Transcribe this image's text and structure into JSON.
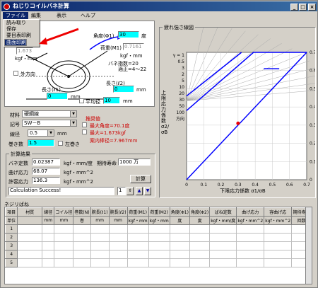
{
  "window": {
    "title": "ねじりコイルバネ計算",
    "min": "_",
    "max": "□",
    "close": "×"
  },
  "menu": [
    {
      "label": "ファイル"
    },
    {
      "label": "編集"
    },
    {
      "label": "表示"
    },
    {
      "label": "ヘルプ"
    }
  ],
  "file_menu": {
    "items": [
      "読み取り",
      "保存",
      "要目表印刷",
      "曲面印刷"
    ],
    "selected": 3
  },
  "diagram": {
    "angle_label": "角度(Φ1)",
    "angle_value": "30",
    "angle_unit": "度",
    "load_label": "荷重(M1)",
    "load_value": "0.7161",
    "load_unit": "kgf・mm",
    "spring_index_label": "バネ指数=20",
    "spring_index_range": "適正=4～22",
    "left_value": "1.673",
    "left_unit": "kgf・mm",
    "outer_dir_label": "外方向",
    "len1_label": "長さ(ℓ1)",
    "len1_value": "0",
    "len1_unit": "mm",
    "parallel_label": "平均径",
    "parallel_value": "10",
    "parallel_unit": "mm",
    "len2_label": "長さ(ℓ2)",
    "len2_value": "0",
    "len2_unit": "mm"
  },
  "material": {
    "material_label": "材料",
    "material_value": "硬鋼線",
    "code_label": "記号",
    "code_value": "SW－B",
    "wire_label": "線径",
    "wire_value": "0.5",
    "wire_unit": "mm",
    "turns_label": "巻き数",
    "turns_value": "1.5",
    "left_wind_label": "左巻き"
  },
  "recommend": {
    "title": "推奨値",
    "max_angle": "最大角度=70.1度",
    "max_force": "最大=1.673kgf",
    "inner_diameter": "案内棒径=7.967mm"
  },
  "results": {
    "title": "計算結果",
    "spring_const_label": "バネ定数",
    "spring_const_value": "0.02387",
    "spring_const_unit": "kgf・mm/度",
    "life_label": "期待寿命",
    "life_value": "1000 万",
    "bend_stress_label": "曲げ応力",
    "bend_stress_value": "68.07",
    "bend_stress_unit": "kgf・mm^2",
    "allow_stress_label": "許容応力",
    "allow_stress_value": "136.3",
    "allow_stress_unit": "kgf・mm^2",
    "calc_button": "計算",
    "message": "Calculation Success!",
    "stepper_value": "1"
  },
  "chart_data": {
    "type": "line",
    "title": "疲れ強さ線図",
    "xlabel": "下限応力係数 σ1/σB",
    "ylabel": "上限応力係数 σ2/σB",
    "x_ticks": [
      "0",
      "0.1",
      "0.2",
      "0.3",
      "0.4",
      "0.5",
      "0.6",
      "0.7"
    ],
    "y_ticks": [
      "0",
      "0.1",
      "0.2",
      "0.3",
      "0.4",
      "0.5",
      "0.6",
      "0.7"
    ],
    "left_ticks": [
      "γ = 1",
      "0.5",
      "3",
      "2",
      "5",
      "10",
      "20",
      "30",
      "50",
      "100",
      "方向"
    ],
    "xlim": [
      0,
      0.7
    ],
    "ylim": [
      0,
      0.7
    ],
    "point": {
      "x": 0.3,
      "y": 0.31
    },
    "series": [
      {
        "values": [
          [
            0,
            0
          ],
          [
            0.7,
            0.7
          ]
        ]
      },
      {
        "values": [
          [
            0,
            0.38
          ],
          [
            0.39,
            0.7
          ],
          [
            0.7,
            0.7
          ]
        ]
      },
      {
        "values": [
          [
            0,
            0.46
          ],
          [
            0.32,
            0.7
          ]
        ]
      },
      {
        "values": [
          [
            0.45,
            0.61
          ],
          [
            0.54,
            0.61
          ]
        ]
      }
    ]
  },
  "table": {
    "title": "ネジリばね",
    "headers": [
      "項目",
      "材質",
      "線径",
      "コイル径",
      "巻数(N)",
      "腕長(ℓ1)",
      "腕長(ℓ2)",
      "荷重(M1)",
      "荷重(M2)",
      "角度(Φ1)",
      "角度(Φ2)",
      "ばね定数",
      "曲げ応力",
      "容曲げ応",
      "期待寿命"
    ],
    "units": [
      "単位",
      "",
      "mm",
      "mm",
      "巻",
      "mm",
      "mm",
      "kgf・mm",
      "kgf・mm",
      "度",
      "度",
      "kgf・mm/度",
      "kgf・mm^2",
      "kgf・mm^2",
      "回数"
    ],
    "rows": [
      "1",
      "2",
      "3",
      "4",
      "5"
    ]
  }
}
